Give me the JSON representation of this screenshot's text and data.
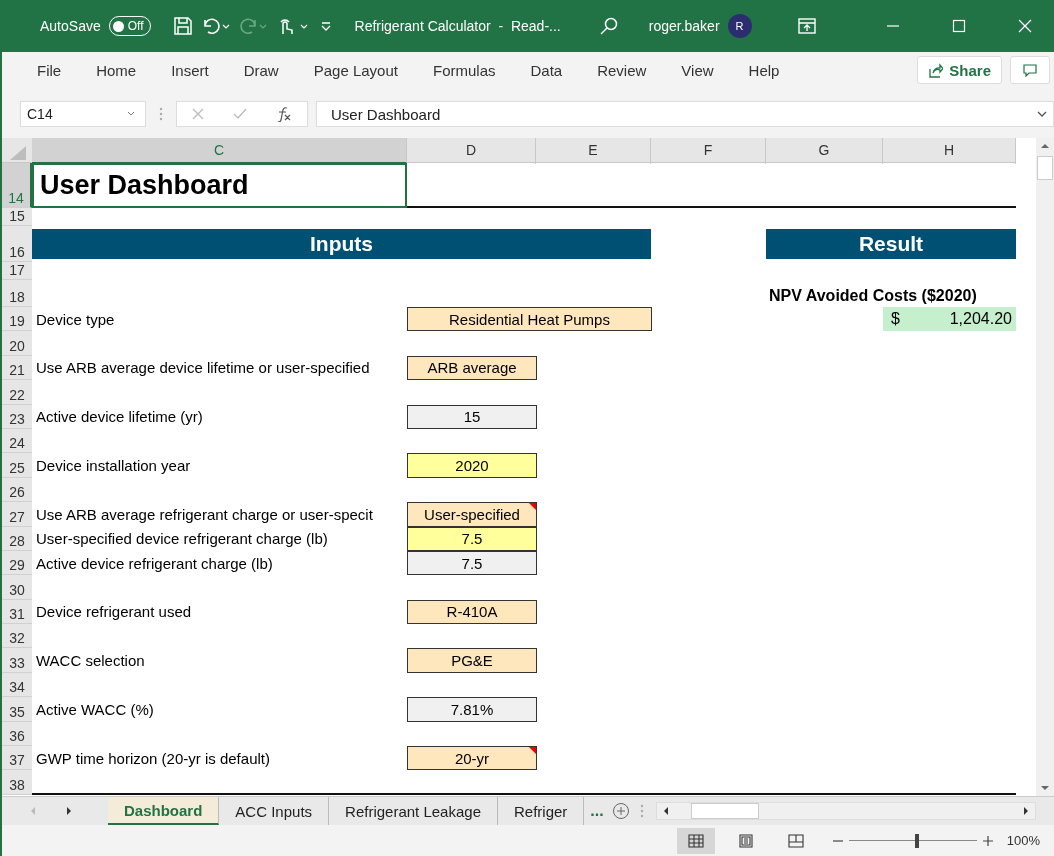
{
  "title_bar": {
    "autosave_label": "AutoSave",
    "autosave_on": false,
    "autosave_state": "Off",
    "title": "Refrigerant Calculator  -  Read-...",
    "user": "roger.baker",
    "avatar": "R"
  },
  "ribbon_tabs": [
    {
      "label": "File",
      "selected": false
    },
    {
      "label": "Home",
      "selected": false
    },
    {
      "label": "Insert",
      "selected": false
    },
    {
      "label": "Draw",
      "selected": false
    },
    {
      "label": "Page Layout",
      "selected": false
    },
    {
      "label": "Formulas",
      "selected": false
    },
    {
      "label": "Data",
      "selected": false
    },
    {
      "label": "Review",
      "selected": false
    },
    {
      "label": "View",
      "selected": false
    },
    {
      "label": "Help",
      "selected": false
    }
  ],
  "share": "Share",
  "formula_bar": {
    "name_box": "C14",
    "content": "User Dashboard"
  },
  "columns": [
    {
      "label": "C",
      "selected": true
    },
    {
      "label": "D",
      "selected": false
    },
    {
      "label": "E",
      "selected": false
    },
    {
      "label": "F",
      "selected": false
    },
    {
      "label": "G",
      "selected": false
    },
    {
      "label": "H",
      "selected": false
    }
  ],
  "rows": [
    {
      "number": "14",
      "kind": "title",
      "text": "User Dashboard",
      "selected": true
    },
    {
      "number": "15",
      "kind": "blank"
    },
    {
      "number": "16",
      "kind": "banners",
      "inputs": "Inputs",
      "result": "Result"
    },
    {
      "number": "17",
      "kind": "blank"
    },
    {
      "number": "18",
      "kind": "result_label",
      "text": "NPV Avoided Costs ($2020)"
    },
    {
      "number": "19",
      "kind": "dropdown",
      "label": "Device type",
      "value": "Residential Heat Pumps",
      "merged": true,
      "comment": false,
      "result": {
        "currency": "$",
        "amount": "1,204.20"
      }
    },
    {
      "number": "20",
      "kind": "blank"
    },
    {
      "number": "21",
      "kind": "dropdown",
      "label": "Use ARB average device lifetime or user-specified",
      "value": "ARB average",
      "merged": false,
      "comment": false
    },
    {
      "number": "22",
      "kind": "blank"
    },
    {
      "number": "23",
      "kind": "computed",
      "label": "Active device lifetime (yr)",
      "value": "15",
      "merged": false,
      "comment": false
    },
    {
      "number": "24",
      "kind": "blank"
    },
    {
      "number": "25",
      "kind": "input",
      "label": "Device installation year",
      "value": "2020",
      "merged": false,
      "comment": false
    },
    {
      "number": "26",
      "kind": "blank"
    },
    {
      "number": "27",
      "kind": "dropdown",
      "label": "Use ARB average refrigerant charge or user-specit",
      "value": "User-specified",
      "merged": false,
      "comment": true
    },
    {
      "number": "28",
      "kind": "input",
      "label": "User-specified device refrigerant charge (lb)",
      "value": "7.5",
      "merged": false,
      "comment": false
    },
    {
      "number": "29",
      "kind": "computed",
      "label": "Active device refrigerant charge (lb)",
      "value": "7.5",
      "merged": false,
      "comment": false
    },
    {
      "number": "30",
      "kind": "blank"
    },
    {
      "number": "31",
      "kind": "dropdown",
      "label": "Device refrigerant used",
      "value": "R-410A",
      "merged": false,
      "comment": false
    },
    {
      "number": "32",
      "kind": "blank"
    },
    {
      "number": "33",
      "kind": "dropdown",
      "label": "WACC selection",
      "value": "PG&E",
      "merged": false,
      "comment": false
    },
    {
      "number": "34",
      "kind": "blank"
    },
    {
      "number": "35",
      "kind": "computed",
      "label": "Active WACC (%)",
      "value": "7.81%",
      "merged": false,
      "comment": false
    },
    {
      "number": "36",
      "kind": "blank"
    },
    {
      "number": "37",
      "kind": "dropdown",
      "label": "GWP time horizon (20-yr is default)",
      "value": "20-yr",
      "merged": false,
      "comment": true
    },
    {
      "number": "38",
      "kind": "blank"
    }
  ],
  "sheet_tabs": [
    {
      "label": "Dashboard",
      "selected": true
    },
    {
      "label": "ACC Inputs",
      "selected": false
    },
    {
      "label": "Refrigerant Leakage",
      "selected": false
    },
    {
      "label": "Refriger",
      "selected": false
    }
  ],
  "sheet_more": "...",
  "zoom": {
    "level": 0.53,
    "reading": "100%"
  }
}
